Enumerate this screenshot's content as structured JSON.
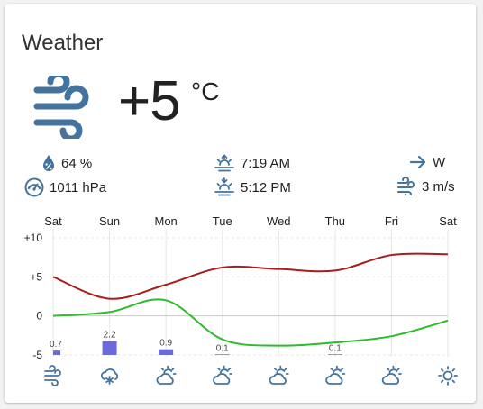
{
  "card": {
    "title": "Weather"
  },
  "current": {
    "condition_icon": "wind-icon",
    "temperature": "+5",
    "unit": "°C"
  },
  "attributes": {
    "humidity": {
      "icon": "water-percent-icon",
      "value": "64 %"
    },
    "pressure": {
      "icon": "gauge-icon",
      "value": "1011 hPa"
    },
    "sunrise": {
      "icon": "sunrise-icon",
      "value": "7:19 AM"
    },
    "sunset": {
      "icon": "sunset-icon",
      "value": "5:12 PM"
    },
    "wind_direction": {
      "icon": "arrow-right-icon",
      "value": "W"
    },
    "wind_speed": {
      "icon": "wind-icon",
      "value": "3 m/s"
    }
  },
  "forecast": {
    "days": [
      "Sat",
      "Sun",
      "Mon",
      "Tue",
      "Wed",
      "Thu",
      "Fri",
      "Sat"
    ],
    "icons": [
      "wind-icon",
      "snowy-icon",
      "partly-cloudy-icon",
      "partly-cloudy-icon",
      "partly-cloudy-icon",
      "partly-cloudy-icon",
      "partly-cloudy-icon",
      "sunny-icon"
    ]
  },
  "chart_data": {
    "type": "line",
    "x": [
      "Sat",
      "Sun",
      "Mon",
      "Tue",
      "Wed",
      "Thu",
      "Fri",
      "Sat"
    ],
    "yticks": [
      "+10",
      "+5",
      "0",
      "-5"
    ],
    "ylim": [
      -5,
      10
    ],
    "series": [
      {
        "values": [
          5,
          2.2,
          4,
          6.2,
          6,
          5.8,
          7.8,
          7.9
        ],
        "color": "#a91c1c"
      },
      {
        "values": [
          0,
          0.5,
          2,
          -3,
          -3.8,
          -3.4,
          -2.6,
          -0.6
        ],
        "color": "#2bbb2b"
      }
    ],
    "precipitation": {
      "values": [
        0.7,
        2.2,
        0.9,
        0.1,
        0,
        0.1,
        0,
        0
      ],
      "labels": [
        "0.7",
        "2.2",
        "0.9",
        "0.1",
        "",
        "0.1",
        "",
        ""
      ],
      "color": "#6a6adb"
    },
    "grid": true
  },
  "colors": {
    "icon": "#44739e",
    "text": "#212121",
    "grid": "#e6e6e6",
    "zero_line": "#c8c8c8"
  }
}
